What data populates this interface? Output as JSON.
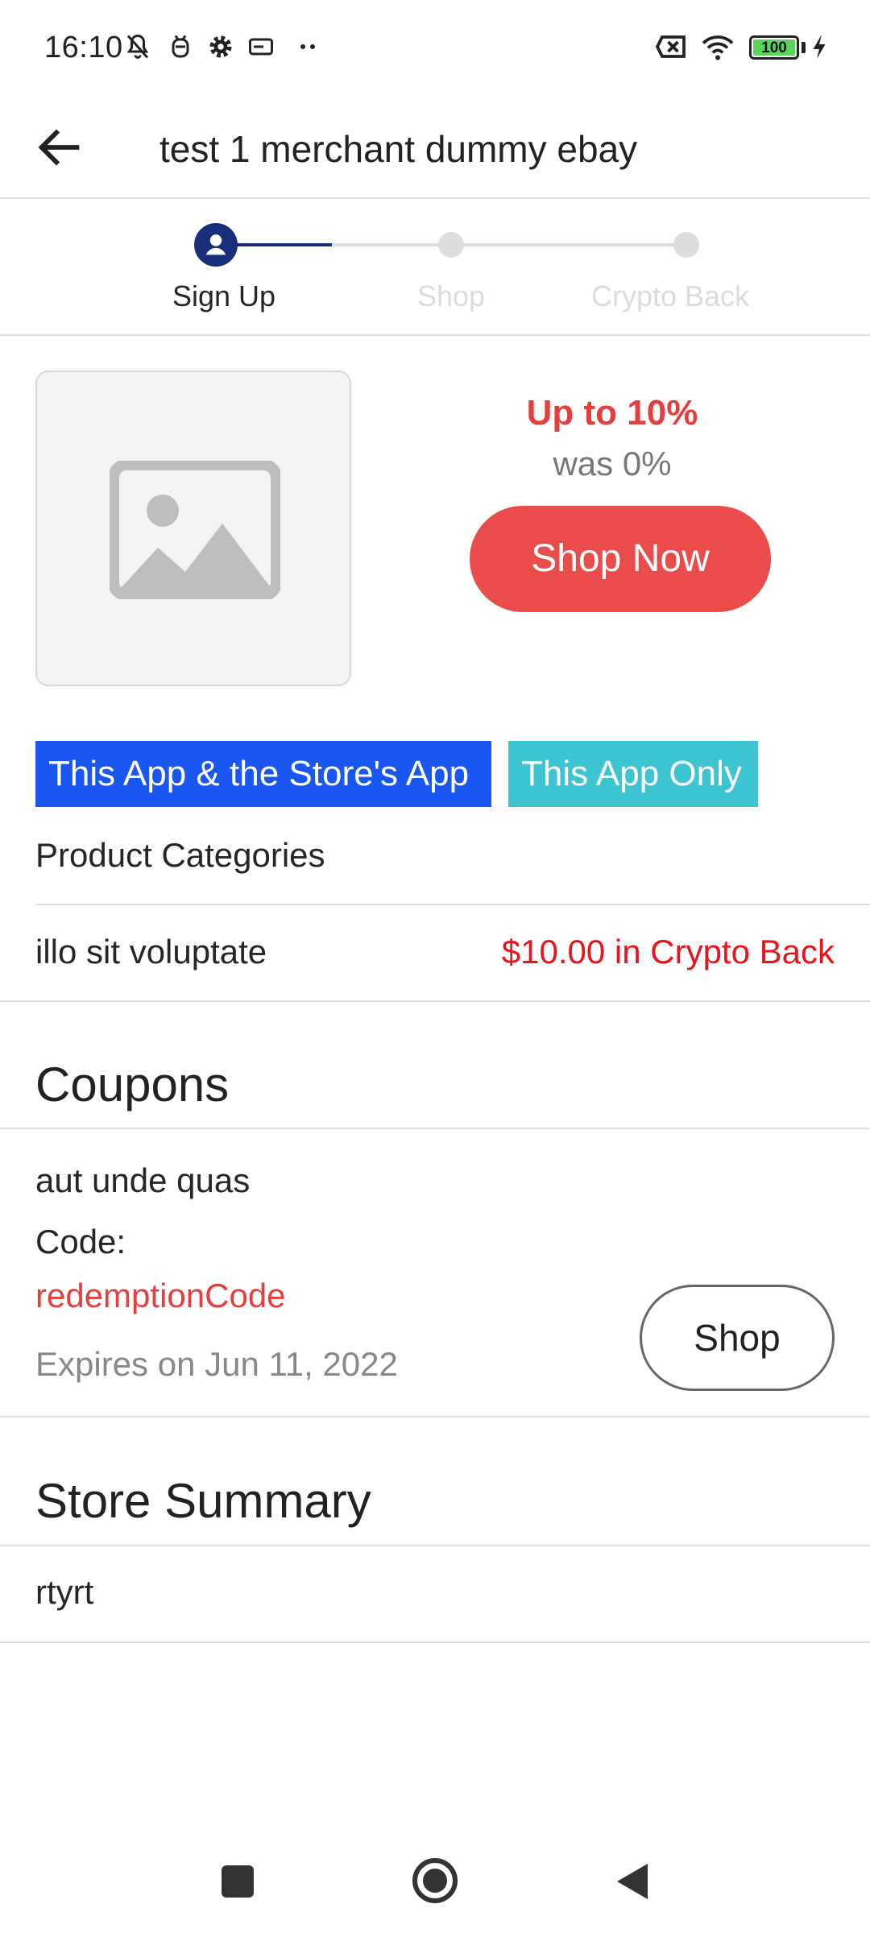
{
  "status_bar": {
    "time": "16:10",
    "battery_level": "100",
    "icons": [
      "bell-off-icon",
      "android-robot-icon",
      "gear-icon",
      "card-icon",
      "more-dots-icon",
      "sim-cross-icon",
      "wifi-icon",
      "battery-icon",
      "charging-bolt-icon"
    ]
  },
  "header": {
    "title": "test 1 merchant dummy ebay",
    "back_icon": "arrow-left-icon"
  },
  "stepper": {
    "steps": [
      {
        "label": "Sign Up",
        "state": "active"
      },
      {
        "label": "Shop",
        "state": "inactive"
      },
      {
        "label": "Crypto Back",
        "state": "inactive"
      }
    ],
    "colors": {
      "active": "#1a2f7a",
      "inactive": "#dddddd"
    }
  },
  "offer": {
    "image_icon": "image-placeholder-icon",
    "rate": "Up to 10%",
    "was": "was 0%",
    "shop_now_label": "Shop Now"
  },
  "tags": {
    "both_apps": "This App & the Store's App",
    "this_app_only": "This App Only"
  },
  "product_categories": {
    "heading": "Product Categories",
    "items": [
      {
        "name": "illo sit voluptate",
        "cashback": "$10.00 in Crypto Back"
      }
    ]
  },
  "coupons": {
    "heading": "Coupons",
    "items": [
      {
        "title": "aut unde quas",
        "code_label": "Code:",
        "code": "redemptionCode",
        "expires": "Expires on Jun 11, 2022",
        "shop_label": "Shop"
      }
    ]
  },
  "store_summary": {
    "heading": "Store Summary",
    "text": "rtyrt"
  },
  "colors": {
    "accent_red": "#ea4c4c",
    "tag_blue": "#1a56f0",
    "tag_teal": "#3cc4d0",
    "cashback_red": "#e8141c"
  },
  "nav_bar": {
    "icons": [
      "recents-square-icon",
      "home-circle-icon",
      "back-triangle-icon"
    ]
  }
}
